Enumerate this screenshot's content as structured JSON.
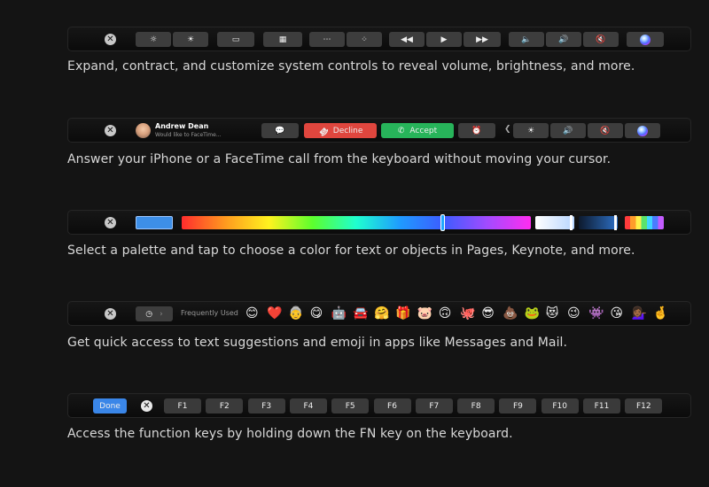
{
  "sections": [
    {
      "caption": "Expand, contract, and customize system controls to reveal volume, brightness, and more."
    },
    {
      "caption": "Answer your iPhone or a FaceTime call from the keyboard without moving your cursor."
    },
    {
      "caption": "Select a palette and tap to choose a color for text or objects in Pages, Keynote, and more."
    },
    {
      "caption": "Get quick access to text suggestions and emoji in apps like Messages and Mail."
    },
    {
      "caption": "Access the function keys by holding down the FN key on the keyboard."
    }
  ],
  "facetime": {
    "caller_name": "Andrew Dean",
    "caller_status": "Would like to FaceTime...",
    "decline_label": "Decline",
    "accept_label": "Accept",
    "decline_color": "#e0463e",
    "accept_color": "#27b45a"
  },
  "emoji_bar": {
    "category_label": "Frequently Used",
    "emojis": [
      "😊",
      "❤️",
      "👵",
      "😋",
      "🤖",
      "🚘",
      "🤗",
      "🎁",
      "🐷",
      "🙃",
      "🐙",
      "😎",
      "💩",
      "🐸",
      "😻",
      "😉",
      "👾",
      "😘",
      "💁🏾‍♀️",
      "🤞"
    ]
  },
  "function_keys": {
    "done_label": "Done",
    "done_color": "#3a86e8",
    "keys": [
      "F1",
      "F2",
      "F3",
      "F4",
      "F5",
      "F6",
      "F7",
      "F8",
      "F9",
      "F10",
      "F11",
      "F12"
    ]
  },
  "icons": {
    "close": "✕",
    "brightness_down": "☼",
    "brightness_up": "☀",
    "mission_control": "▭",
    "launchpad": "▦",
    "kb_light_down": "⋯",
    "kb_light_up": "⁘",
    "rewind": "◀◀",
    "play": "▶",
    "fast_forward": "▶▶",
    "volume_down": "🔈",
    "volume_up": "🔊",
    "mute": "🔇",
    "message": "💬",
    "decline": "☎",
    "accept": "✆",
    "alarm": "⏰",
    "chevron_left": "❮",
    "clock": "◷",
    "chevron_right": "›"
  }
}
